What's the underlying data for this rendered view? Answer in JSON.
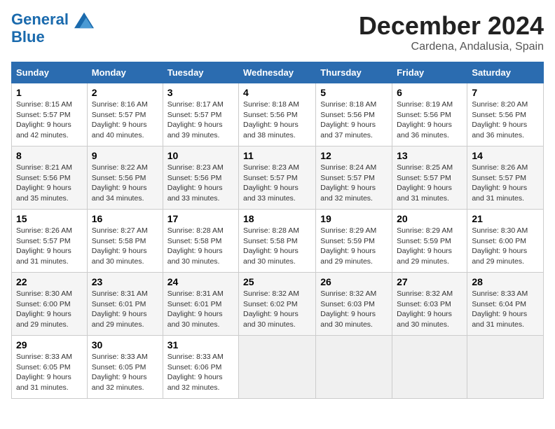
{
  "logo": {
    "line1": "General",
    "line2": "Blue"
  },
  "header": {
    "month": "December 2024",
    "location": "Cardena, Andalusia, Spain"
  },
  "days_of_week": [
    "Sunday",
    "Monday",
    "Tuesday",
    "Wednesday",
    "Thursday",
    "Friday",
    "Saturday"
  ],
  "weeks": [
    [
      {
        "day": "1",
        "sunrise": "8:15 AM",
        "sunset": "5:57 PM",
        "daylight": "9 hours and 42 minutes."
      },
      {
        "day": "2",
        "sunrise": "8:16 AM",
        "sunset": "5:57 PM",
        "daylight": "9 hours and 40 minutes."
      },
      {
        "day": "3",
        "sunrise": "8:17 AM",
        "sunset": "5:57 PM",
        "daylight": "9 hours and 39 minutes."
      },
      {
        "day": "4",
        "sunrise": "8:18 AM",
        "sunset": "5:56 PM",
        "daylight": "9 hours and 38 minutes."
      },
      {
        "day": "5",
        "sunrise": "8:18 AM",
        "sunset": "5:56 PM",
        "daylight": "9 hours and 37 minutes."
      },
      {
        "day": "6",
        "sunrise": "8:19 AM",
        "sunset": "5:56 PM",
        "daylight": "9 hours and 36 minutes."
      },
      {
        "day": "7",
        "sunrise": "8:20 AM",
        "sunset": "5:56 PM",
        "daylight": "9 hours and 36 minutes."
      }
    ],
    [
      {
        "day": "8",
        "sunrise": "8:21 AM",
        "sunset": "5:56 PM",
        "daylight": "9 hours and 35 minutes."
      },
      {
        "day": "9",
        "sunrise": "8:22 AM",
        "sunset": "5:56 PM",
        "daylight": "9 hours and 34 minutes."
      },
      {
        "day": "10",
        "sunrise": "8:23 AM",
        "sunset": "5:56 PM",
        "daylight": "9 hours and 33 minutes."
      },
      {
        "day": "11",
        "sunrise": "8:23 AM",
        "sunset": "5:57 PM",
        "daylight": "9 hours and 33 minutes."
      },
      {
        "day": "12",
        "sunrise": "8:24 AM",
        "sunset": "5:57 PM",
        "daylight": "9 hours and 32 minutes."
      },
      {
        "day": "13",
        "sunrise": "8:25 AM",
        "sunset": "5:57 PM",
        "daylight": "9 hours and 31 minutes."
      },
      {
        "day": "14",
        "sunrise": "8:26 AM",
        "sunset": "5:57 PM",
        "daylight": "9 hours and 31 minutes."
      }
    ],
    [
      {
        "day": "15",
        "sunrise": "8:26 AM",
        "sunset": "5:57 PM",
        "daylight": "9 hours and 31 minutes."
      },
      {
        "day": "16",
        "sunrise": "8:27 AM",
        "sunset": "5:58 PM",
        "daylight": "9 hours and 30 minutes."
      },
      {
        "day": "17",
        "sunrise": "8:28 AM",
        "sunset": "5:58 PM",
        "daylight": "9 hours and 30 minutes."
      },
      {
        "day": "18",
        "sunrise": "8:28 AM",
        "sunset": "5:58 PM",
        "daylight": "9 hours and 30 minutes."
      },
      {
        "day": "19",
        "sunrise": "8:29 AM",
        "sunset": "5:59 PM",
        "daylight": "9 hours and 29 minutes."
      },
      {
        "day": "20",
        "sunrise": "8:29 AM",
        "sunset": "5:59 PM",
        "daylight": "9 hours and 29 minutes."
      },
      {
        "day": "21",
        "sunrise": "8:30 AM",
        "sunset": "6:00 PM",
        "daylight": "9 hours and 29 minutes."
      }
    ],
    [
      {
        "day": "22",
        "sunrise": "8:30 AM",
        "sunset": "6:00 PM",
        "daylight": "9 hours and 29 minutes."
      },
      {
        "day": "23",
        "sunrise": "8:31 AM",
        "sunset": "6:01 PM",
        "daylight": "9 hours and 29 minutes."
      },
      {
        "day": "24",
        "sunrise": "8:31 AM",
        "sunset": "6:01 PM",
        "daylight": "9 hours and 30 minutes."
      },
      {
        "day": "25",
        "sunrise": "8:32 AM",
        "sunset": "6:02 PM",
        "daylight": "9 hours and 30 minutes."
      },
      {
        "day": "26",
        "sunrise": "8:32 AM",
        "sunset": "6:03 PM",
        "daylight": "9 hours and 30 minutes."
      },
      {
        "day": "27",
        "sunrise": "8:32 AM",
        "sunset": "6:03 PM",
        "daylight": "9 hours and 30 minutes."
      },
      {
        "day": "28",
        "sunrise": "8:33 AM",
        "sunset": "6:04 PM",
        "daylight": "9 hours and 31 minutes."
      }
    ],
    [
      {
        "day": "29",
        "sunrise": "8:33 AM",
        "sunset": "6:05 PM",
        "daylight": "9 hours and 31 minutes."
      },
      {
        "day": "30",
        "sunrise": "8:33 AM",
        "sunset": "6:05 PM",
        "daylight": "9 hours and 32 minutes."
      },
      {
        "day": "31",
        "sunrise": "8:33 AM",
        "sunset": "6:06 PM",
        "daylight": "9 hours and 32 minutes."
      },
      null,
      null,
      null,
      null
    ]
  ]
}
